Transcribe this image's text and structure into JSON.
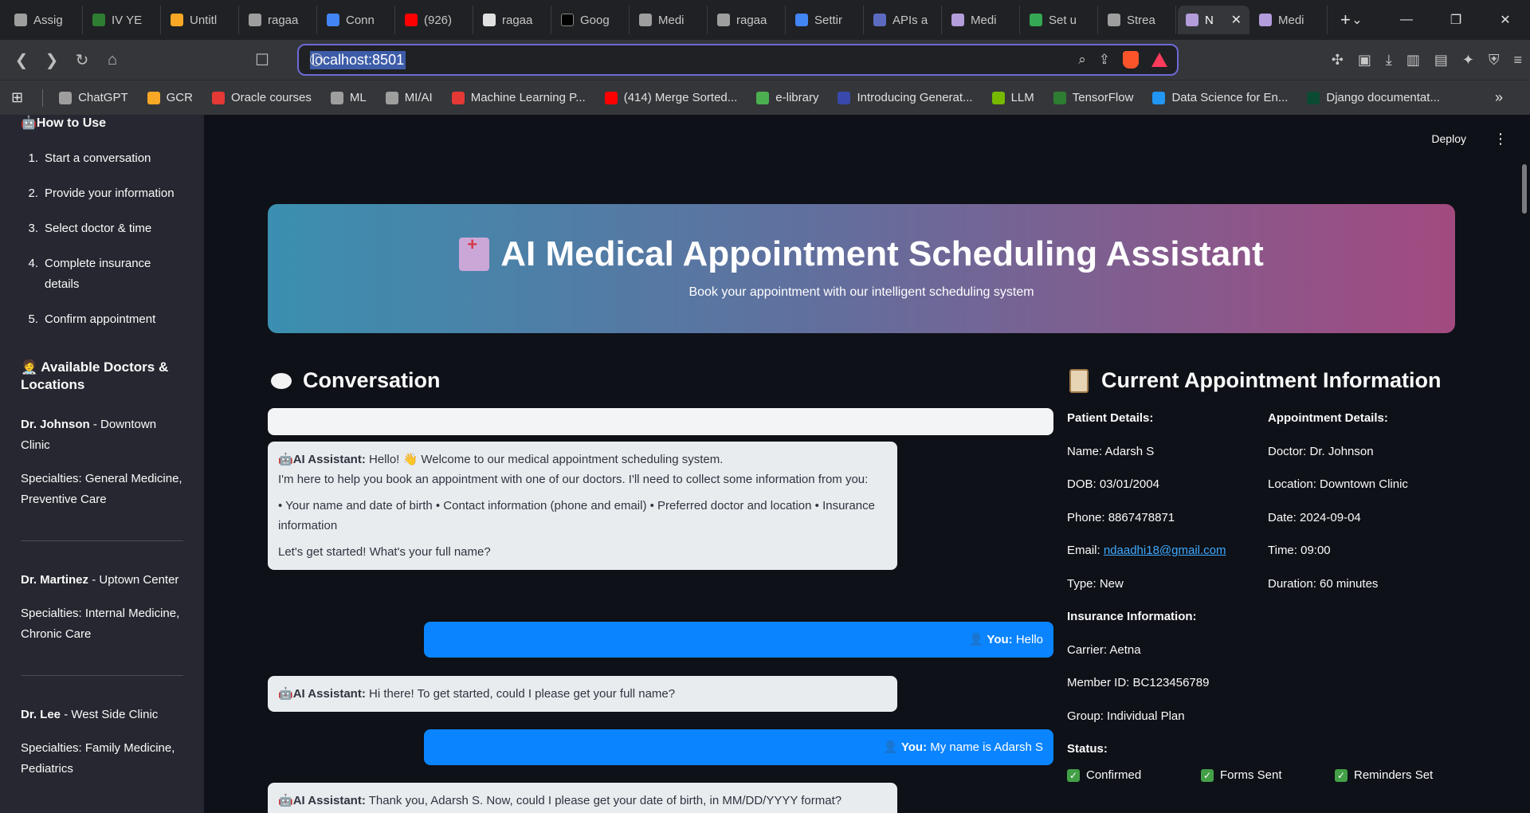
{
  "browser": {
    "tabs": [
      {
        "label": "Assig",
        "color": "#9e9e9e"
      },
      {
        "label": "IV YE",
        "color": "#2e7d32"
      },
      {
        "label": "Untitl",
        "color": "#f9a825"
      },
      {
        "label": "ragaa",
        "color": "#9e9e9e"
      },
      {
        "label": "Conn",
        "color": "#4285f4"
      },
      {
        "label": "(926)",
        "color": "#ff0000"
      },
      {
        "label": "ragaa",
        "color": "#e0e0e0"
      },
      {
        "label": "Goog",
        "color": "#000000"
      },
      {
        "label": "Medi",
        "color": "#9e9e9e"
      },
      {
        "label": "ragaa",
        "color": "#9e9e9e"
      },
      {
        "label": "Settir",
        "color": "#4285f4"
      },
      {
        "label": "APIs a",
        "color": "#5c6bc0"
      },
      {
        "label": "Medi",
        "color": "#b39ddb"
      },
      {
        "label": "Set u",
        "color": "#34a853"
      },
      {
        "label": "Strea",
        "color": "#9e9e9e"
      }
    ],
    "active_tab": {
      "label": "N",
      "color": "#b39ddb"
    },
    "after_tab": {
      "label": "Medi",
      "color": "#b39ddb"
    },
    "new_tab": "+",
    "url": "localhost:8501",
    "bookmarks": [
      {
        "label": "ChatGPT",
        "color": "#9e9e9e"
      },
      {
        "label": "GCR",
        "color": "#f9a825"
      },
      {
        "label": "Oracle courses",
        "color": "#e53935"
      },
      {
        "label": "ML",
        "color": "#9e9e9e"
      },
      {
        "label": "MI/AI",
        "color": "#9e9e9e"
      },
      {
        "label": "Machine Learning P...",
        "color": "#e53935"
      },
      {
        "label": "(414) Merge Sorted...",
        "color": "#ff0000"
      },
      {
        "label": "e-library",
        "color": "#4caf50"
      },
      {
        "label": "Introducing Generat...",
        "color": "#3949ab"
      },
      {
        "label": "LLM",
        "color": "#76b900"
      },
      {
        "label": "TensorFlow",
        "color": "#2e7d32"
      },
      {
        "label": "Data Science for En...",
        "color": "#2196f3"
      },
      {
        "label": "Django documentat...",
        "color": "#0c4b33"
      }
    ]
  },
  "sidebar": {
    "how_to_use": "🤖How to Use",
    "steps": [
      {
        "n": "1.",
        "text": "Start a conversation"
      },
      {
        "n": "2.",
        "text": "Provide your information"
      },
      {
        "n": "3.",
        "text": "Select doctor & time"
      },
      {
        "n": "4.",
        "text": "Complete insurance details"
      },
      {
        "n": "5.",
        "text": "Confirm appointment"
      }
    ],
    "doctors_heading": "Available Doctors & Locations",
    "doctors": [
      {
        "name": "Dr. Johnson",
        "location": " - Downtown Clinic",
        "specialties": "Specialties: General Medicine, Preventive Care"
      },
      {
        "name": "Dr. Martinez",
        "location": " - Uptown Center",
        "specialties": "Specialties: Internal Medicine, Chronic Care"
      },
      {
        "name": "Dr. Lee",
        "location": " - West Side Clinic",
        "specialties": "Specialties: Family Medicine, Pediatrics"
      }
    ]
  },
  "header": {
    "deploy": "Deploy",
    "menu": "⋮"
  },
  "hero": {
    "title": "AI Medical Appointment Scheduling Assistant",
    "subtitle": "Book your appointment with our intelligent scheduling system"
  },
  "conversation": {
    "heading": "Conversation",
    "messages": [
      {
        "role": "ai",
        "speaker": "AI Assistant:",
        "text": "Hello! 👋 Welcome to our medical appointment scheduling system.",
        "line2": "I'm here to help you book an appointment with one of our doctors. I'll need to collect some information from you:",
        "line3": "• Your name and date of birth • Contact information (phone and email) • Preferred doctor and location • Insurance information",
        "line4": "Let's get started! What's your full name?"
      },
      {
        "role": "user",
        "speaker": "You:",
        "text": "Hello"
      },
      {
        "role": "ai",
        "speaker": "AI Assistant:",
        "text": "Hi there! To get started, could I please get your full name?"
      },
      {
        "role": "user",
        "speaker": "You:",
        "text": "My name is Adarsh S"
      },
      {
        "role": "ai",
        "speaker": "AI Assistant:",
        "text": "Thank you, Adarsh S. Now, could I please get your date of birth, in MM/DD/YYYY format?"
      }
    ]
  },
  "current": {
    "heading": "Current Appointment Information",
    "patient": {
      "heading": "Patient Details:",
      "name": "Name: Adarsh S",
      "dob": "DOB: 03/01/2004",
      "phone": "Phone: 8867478871",
      "email_label": "Email: ",
      "email": "ndaadhi18@gmail.com",
      "type": "Type: New"
    },
    "insurance": {
      "heading": "Insurance Information:",
      "carrier": "Carrier: Aetna",
      "member": "Member ID: BC123456789",
      "group": "Group: Individual Plan"
    },
    "appointment": {
      "heading": "Appointment Details:",
      "doctor": "Doctor: Dr. Johnson",
      "location": "Location: Downtown Clinic",
      "date": "Date: 2024-09-04",
      "time": "Time: 09:00",
      "duration": "Duration: 60 minutes"
    },
    "status": {
      "heading": "Status:",
      "items": [
        "Confirmed",
        "Forms Sent",
        "Reminders Set"
      ]
    }
  },
  "colors": {
    "accent_user": "#0a84ff",
    "status_check": "#43a047"
  }
}
